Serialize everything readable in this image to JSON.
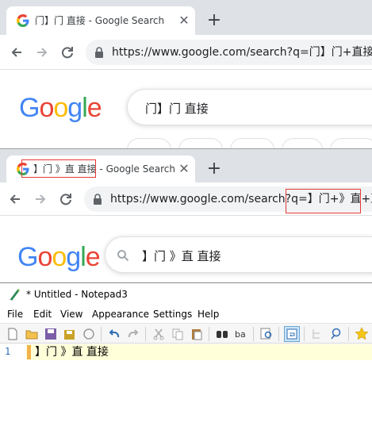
{
  "browser1": {
    "tab_title": "门】门 直接 - Google Search",
    "tab_close": "✕",
    "new_tab": "+",
    "url": "https://www.google.com/search?q=门】门+直接&sc",
    "logo": "Google",
    "query": "门】门 直接"
  },
  "browser2": {
    "tab_title": "】门 》直 直接 - Google Search",
    "tab_close": "✕",
    "new_tab": "+",
    "url": "https://www.google.com/search?q=】门+》直+直接&sc",
    "logo": "Google",
    "query": "】门 》直 直接"
  },
  "notepad": {
    "title": "* Untitled - Notepad3",
    "menu": [
      "File",
      "Edit",
      "View",
      "Appearance",
      "Settings",
      "Help"
    ],
    "line_number": "1",
    "line_text": "】门 》直 直接"
  },
  "colors": {
    "google_blue": "#4285F4",
    "google_red": "#EA4335",
    "google_yellow": "#FBBC05",
    "google_green": "#34A853",
    "highlight_red": "#e53935",
    "current_line": "#ffffd9"
  },
  "icons": {
    "favicon": "google-g-icon",
    "back": "arrow-left-icon",
    "forward": "arrow-right-icon",
    "reload": "reload-icon",
    "lock": "lock-icon",
    "search": "magnifier-icon",
    "notepad_app": "notepad3-icon"
  }
}
